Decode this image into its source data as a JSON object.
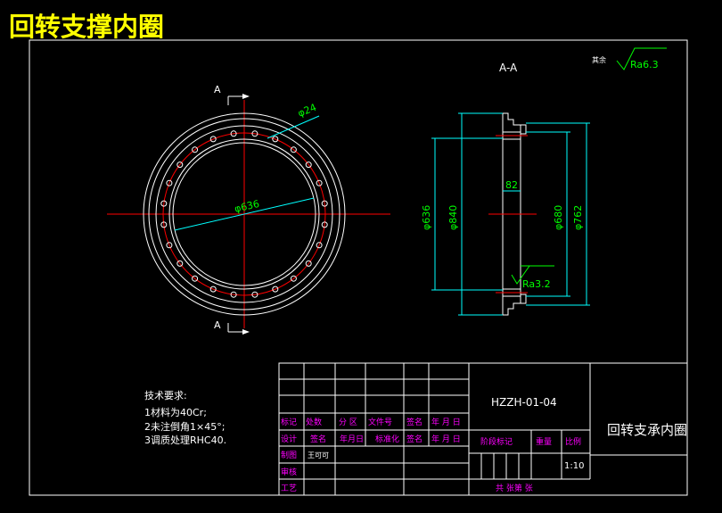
{
  "app_title": "回转支撑内圈",
  "section_label": "A-A",
  "cut_label": "A",
  "roughness_general_prefix": "其余",
  "roughness_general": "Ra6.3",
  "roughness_local": "Ra3.2",
  "dims": {
    "bolt_hole": "φ24",
    "inner_dia_front": "φ636",
    "inner_dia_side": "φ636",
    "dia_840": "φ840",
    "dia_680": "φ680",
    "dia_762": "φ762",
    "width_82": "82"
  },
  "tech_req": {
    "heading": "技术要求:",
    "items": [
      "1材料为40Cr;",
      "2未注倒角1×45°;",
      "3调质处理RHC40."
    ]
  },
  "title_block": {
    "drawing_no": "HZZH-01-04",
    "part_name": "回转支承内圈",
    "scale": "1:10",
    "labels": {
      "biaoji": "标记",
      "chushu": "处数",
      "fenqu": "分 区",
      "wenjianhao": "文件号",
      "qianming": "签名",
      "nianyueri": "年 月 日",
      "sheji": "设计",
      "qianming2": "签名",
      "nianyueri2": "年月日",
      "biaozhunhua": "标准化",
      "qianming3": "签名",
      "nianyueri3": "年 月 日",
      "jieduan": "阶段标记",
      "zhongliang": "重量",
      "bili": "比例",
      "zhitu": "制图",
      "designer": "王可可",
      "shenhe": "审核",
      "gongyi": "工艺",
      "sheet": "共  张第  张"
    }
  },
  "colors": {
    "background": "#000000",
    "line": "#ffffff",
    "centerline": "#ff0000",
    "dimension": "#00ffff",
    "dim_text": "#00ff00",
    "title_text": "#ffff00",
    "title_block_text": "#ff00ff"
  }
}
